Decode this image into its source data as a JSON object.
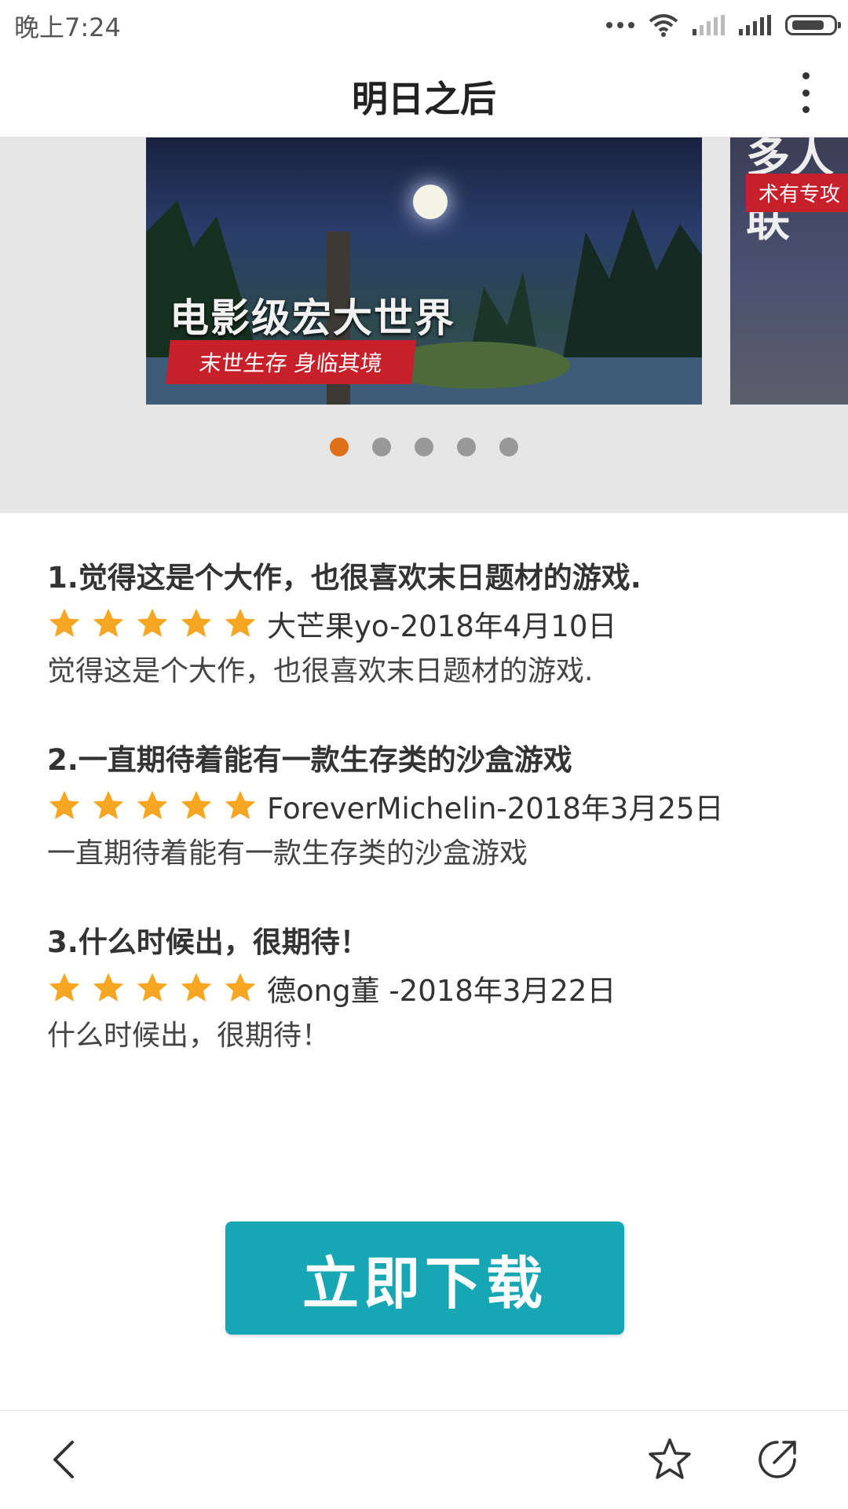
{
  "status_bar": {
    "time": "晚上7:24"
  },
  "header": {
    "title": "明日之后"
  },
  "carousel": {
    "slides": [
      {
        "headline": "电影级宏大世界",
        "tag": "末世生存 身临其境"
      },
      {
        "headline": "多人联",
        "tag": "术有专攻"
      }
    ],
    "page_count": 5,
    "active_index": 0,
    "active_color": "#e07018"
  },
  "reviews": [
    {
      "title": "1.觉得这是个大作，也很喜欢末日题材的游戏.",
      "rating": 5,
      "author": "大芒果yo-2018年4月10日",
      "body": "觉得这是个大作，也很喜欢末日题材的游戏."
    },
    {
      "title": "2.一直期待着能有一款生存类的沙盒游戏",
      "rating": 5,
      "author": "ForeverMichelin-2018年3月25日",
      "body": "一直期待着能有一款生存类的沙盒游戏"
    },
    {
      "title": "3.什么时候出，很期待！",
      "rating": 5,
      "author": "德ong董 -2018年3月22日",
      "body": "什么时候出，很期待！"
    }
  ],
  "download": {
    "label": "立即下载",
    "color": "#17a6b4"
  },
  "bottom_nav": {
    "icons": [
      "back-icon",
      "star-outline-icon",
      "share-icon"
    ]
  },
  "colors": {
    "star": "#f5a623"
  }
}
